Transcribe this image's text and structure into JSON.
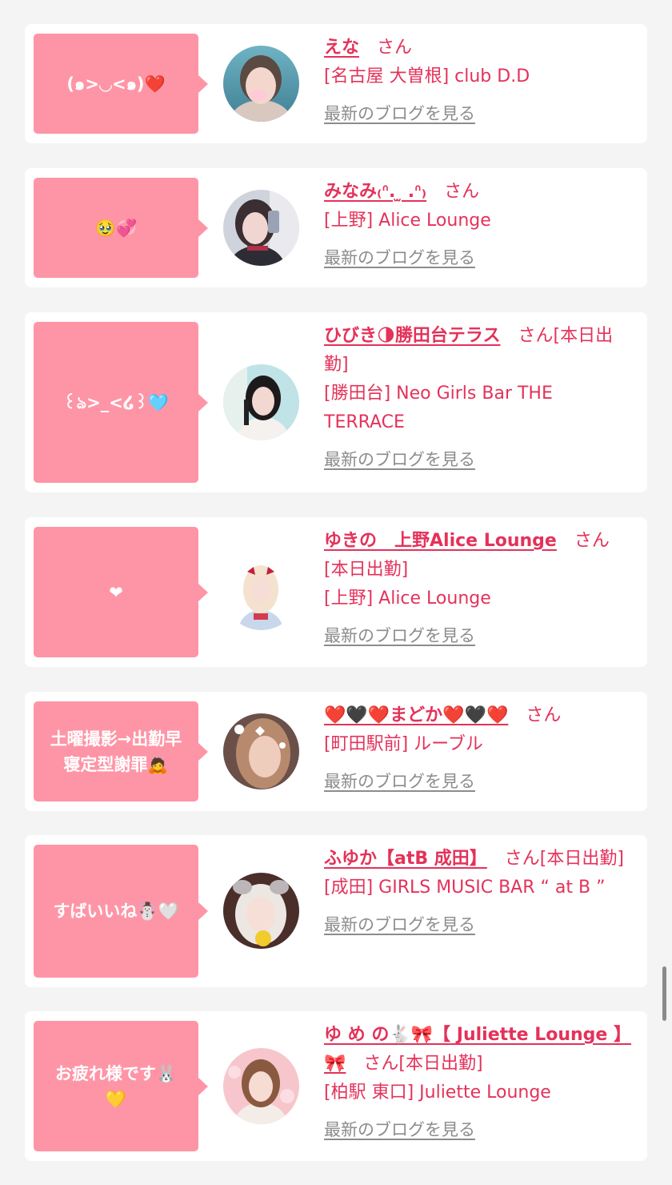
{
  "colors": {
    "bubble": "#fe95a6",
    "accent": "#e4325a",
    "link_gray": "#8c8c8c",
    "background": "#f4f4f4"
  },
  "blog_link_label": "最新のブログを見る",
  "entries": [
    {
      "message": "(๑>◡<๑)❤️",
      "name": "えな",
      "suffix": "さん",
      "shop": "[名古屋 大曽根] club D.D",
      "avatar_icon": "profile-photo"
    },
    {
      "message": "🥹💞",
      "name": "みなみ₍ᐢ. ̫ .ᐢ₎",
      "suffix": "さん",
      "shop": "[上野] Alice Lounge",
      "avatar_icon": "profile-photo"
    },
    {
      "message": "꒰ঌ>_<໒꒱🩵",
      "name": "ひびき🌗勝田台テラス",
      "suffix": "さん[本日出勤]",
      "shop": "[勝田台] Neo Girls Bar THE TERRACE",
      "avatar_icon": "profile-photo"
    },
    {
      "message": "❤",
      "name": "ゆきの　上野Alice Lounge",
      "suffix": "さん[本日出勤]",
      "shop": "[上野] Alice Lounge",
      "avatar_icon": "profile-photo"
    },
    {
      "message": "土曜撮影→出勤早\n寝定型謝罪🙇",
      "name": "❤️🖤❤️まどか❤️🖤❤️",
      "suffix": "さん",
      "shop": "[町田駅前] ルーブル",
      "avatar_icon": "profile-photo"
    },
    {
      "message": "すばいいね☃️🤍",
      "name": "ふゆか【atB 成田】",
      "suffix": "さん[本日出勤]",
      "shop": "[成田] GIRLS MUSIC BAR “ at B ”",
      "avatar_icon": "profile-photo"
    },
    {
      "message": "お疲れ様です🐰\n💛",
      "name": "ゆ め の🐇🎀【 Juliette Lounge 】🎀",
      "suffix": "さん[本日出勤]",
      "shop": "[柏駅 東口] Juliette Lounge",
      "avatar_icon": "profile-photo"
    }
  ]
}
